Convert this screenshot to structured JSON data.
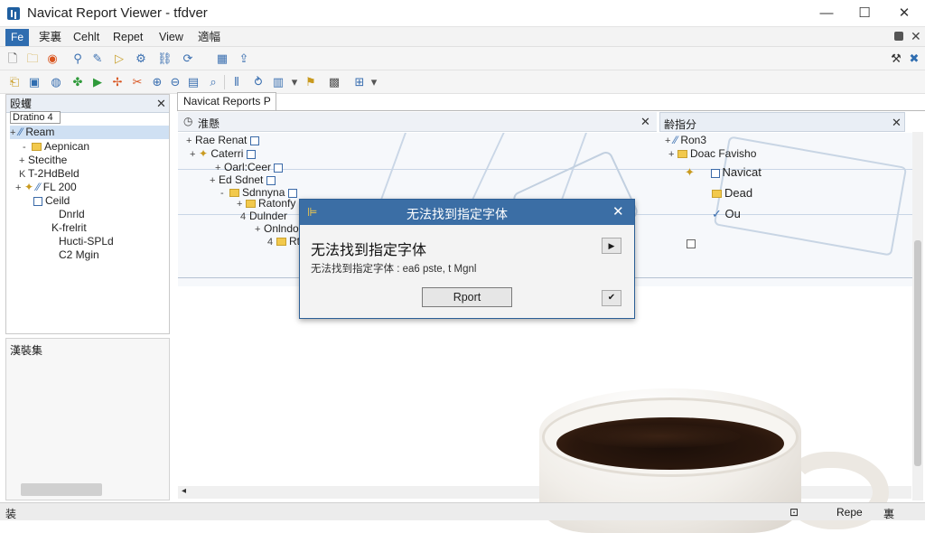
{
  "window": {
    "title": "Navicat Report Viewer - tfdver",
    "controls": [
      "—",
      "☐",
      "✕"
    ]
  },
  "menubar": {
    "items": [
      "Fe",
      "実裏",
      "Cehlt",
      "Repet",
      "View",
      "適幅"
    ]
  },
  "left_panel": {
    "title": "殴蠼",
    "dropdown": "Dratino 4",
    "tree": [
      "Ream",
      "Aepnican",
      "Stecithe",
      "T-2HdBeld",
      "FL 200",
      "Ceild",
      "Dnrld",
      "K-frelrit",
      "Hucti-SPLd",
      "C2 Mgin"
    ],
    "bottom_title": "漢裝集"
  },
  "tab": {
    "label": "Navicat Reports P"
  },
  "center_panel": {
    "title": "淮懸",
    "tree": [
      "Rae Renat",
      "Caterri",
      "Oarl:Ceer",
      "Ed Sdnet",
      "Sdnnyna",
      "Ratonfy",
      "Dulnder",
      "Onlndon",
      "Rtol:n"
    ]
  },
  "right_panel": {
    "title": "齢指分",
    "tree": [
      "Ron3",
      "Doac Favisho",
      "Navicat",
      "Dead",
      "Ou"
    ]
  },
  "dialog": {
    "title": "无法找到指定字体",
    "heading": "无法找到指定字体",
    "message": "无法找到指定字体 : ea6 pste, t Mgnl",
    "button": "Rport",
    "icon_name": "report-icon"
  },
  "statusbar": {
    "left_text": "装",
    "right_text": "Repe",
    "right_char": "裏"
  },
  "colors": {
    "accent": "#3b6ea5",
    "menu_highlight": "#2f6db0",
    "folder": "#f2c94c"
  }
}
